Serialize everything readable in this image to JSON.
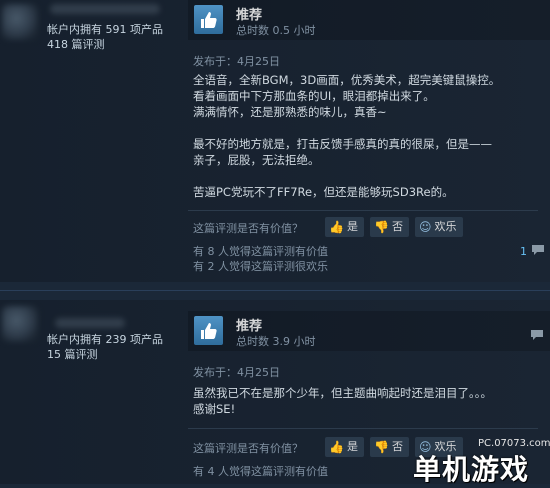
{
  "reviews": [
    {
      "author_stats": {
        "products_line": "帐户内拥有 591 项产品",
        "reviews_line": "418 篇评测"
      },
      "recommendation": "推荐",
      "hours": "总时数 0.5 小时",
      "posted": "发布于：4月25日",
      "body": "全语音，全新BGM，3D画面，优秀美术，超完美键鼠操控。\n看着画面中下方那血条的UI，眼泪都掉出来了。\n满满情怀，还是那熟悉的味儿，真香~\n\n最不好的地方就是，打击反馈手感真的真的很屎，但是——\n亲子，屁股，无法拒绝。\n\n苦逼PC党玩不了FF7Re，但还是能够玩SD3Re的。",
      "helpful_question": "这篇评测是否有价值？",
      "buttons": {
        "yes": "是",
        "no": "否",
        "funny": "欢乐"
      },
      "found_helpful": "有 8 人觉得这篇评测有价值",
      "found_funny": "有 2 人觉得这篇评测很欢乐",
      "comment_count": "1"
    },
    {
      "author_stats": {
        "products_line": "帐户内拥有 239 项产品",
        "reviews_line": "15 篇评测"
      },
      "recommendation": "推荐",
      "hours": "总时数 3.9 小时",
      "posted": "发布于：4月25日",
      "body": "虽然我已不在是那个少年，但主题曲响起时还是泪目了。。。\n感谢SE!",
      "helpful_question": "这篇评测是否有价值？",
      "buttons": {
        "yes": "是",
        "no": "否",
        "funny": "欢乐"
      },
      "found_helpful": "有 4 人觉得这篇评测有价值"
    }
  ],
  "watermark": {
    "site": "PC.07073.com",
    "logo": "单机游戏"
  },
  "icons": {
    "recommend": "thumbs-up-icon",
    "comment": "comment-icon"
  },
  "colors": {
    "accent": "#66c0f4",
    "thumb_bg": "#3f84b8",
    "page_bg": "#1b2838"
  }
}
